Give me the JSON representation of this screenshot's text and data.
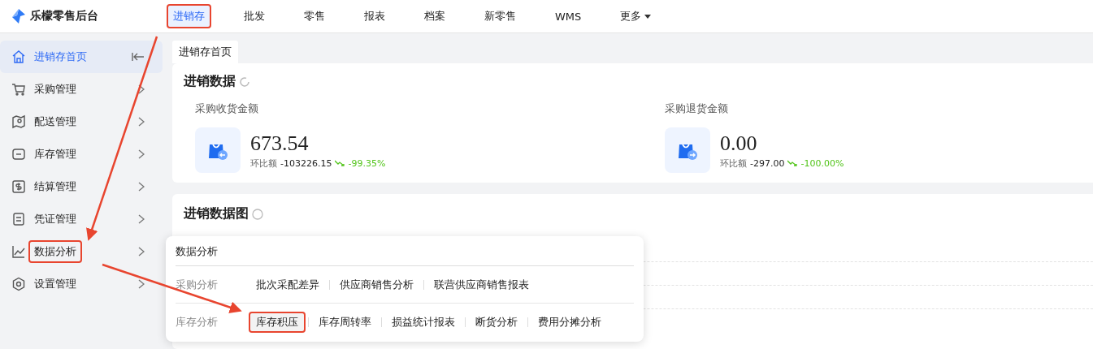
{
  "app": {
    "logo_text": "乐檬零售后台"
  },
  "top_nav": [
    {
      "label": "进销存",
      "selected": true,
      "annotated": true,
      "has_caret": false
    },
    {
      "label": "批发",
      "selected": false,
      "annotated": false,
      "has_caret": false
    },
    {
      "label": "零售",
      "selected": false,
      "annotated": false,
      "has_caret": false
    },
    {
      "label": "报表",
      "selected": false,
      "annotated": false,
      "has_caret": false
    },
    {
      "label": "档案",
      "selected": false,
      "annotated": false,
      "has_caret": false
    },
    {
      "label": "新零售",
      "selected": false,
      "annotated": false,
      "has_caret": false
    },
    {
      "label": "WMS",
      "selected": false,
      "annotated": false,
      "has_caret": false
    },
    {
      "label": "更多",
      "selected": false,
      "annotated": false,
      "has_caret": true
    }
  ],
  "sidebar": {
    "items": [
      {
        "label": "进销存首页",
        "kind": "home",
        "selected": true,
        "annotated": false
      },
      {
        "label": "采购管理",
        "kind": "cart",
        "selected": false,
        "annotated": false
      },
      {
        "label": "配送管理",
        "kind": "map",
        "selected": false,
        "annotated": false
      },
      {
        "label": "库存管理",
        "kind": "box",
        "selected": false,
        "annotated": false
      },
      {
        "label": "结算管理",
        "kind": "dollar",
        "selected": false,
        "annotated": false
      },
      {
        "label": "凭证管理",
        "kind": "doc",
        "selected": false,
        "annotated": false
      },
      {
        "label": "数据分析",
        "kind": "chart",
        "selected": false,
        "annotated": true
      },
      {
        "label": "设置管理",
        "kind": "gear",
        "selected": false,
        "annotated": false
      }
    ]
  },
  "tabs": [
    {
      "label": "进销存首页",
      "selected": true
    }
  ],
  "summary": {
    "title": "进销数据",
    "metrics": [
      {
        "label": "采购收货金额",
        "value": "673.54",
        "compare_label": "环比额",
        "compare_value": "-103226.15",
        "change": "-99.35%",
        "kind": "receive"
      },
      {
        "label": "采购退货金额",
        "value": "0.00",
        "compare_label": "环比额",
        "compare_value": "-297.00",
        "change": "-100.00%",
        "kind": "return"
      }
    ]
  },
  "chart_panel": {
    "title": "进销数据图"
  },
  "popup": {
    "title": "数据分析",
    "groups": [
      {
        "label": "采购分析",
        "links": [
          {
            "label": "批次采配差异",
            "annotated": false
          },
          {
            "label": "供应商销售分析",
            "annotated": false
          },
          {
            "label": "联营供应商销售报表",
            "annotated": false
          }
        ]
      },
      {
        "label": "库存分析",
        "links": [
          {
            "label": "库存积压",
            "annotated": true
          },
          {
            "label": "库存周转率",
            "annotated": false
          },
          {
            "label": "损益统计报表",
            "annotated": false
          },
          {
            "label": "断货分析",
            "annotated": false
          },
          {
            "label": "费用分摊分析",
            "annotated": false
          }
        ]
      }
    ]
  }
}
